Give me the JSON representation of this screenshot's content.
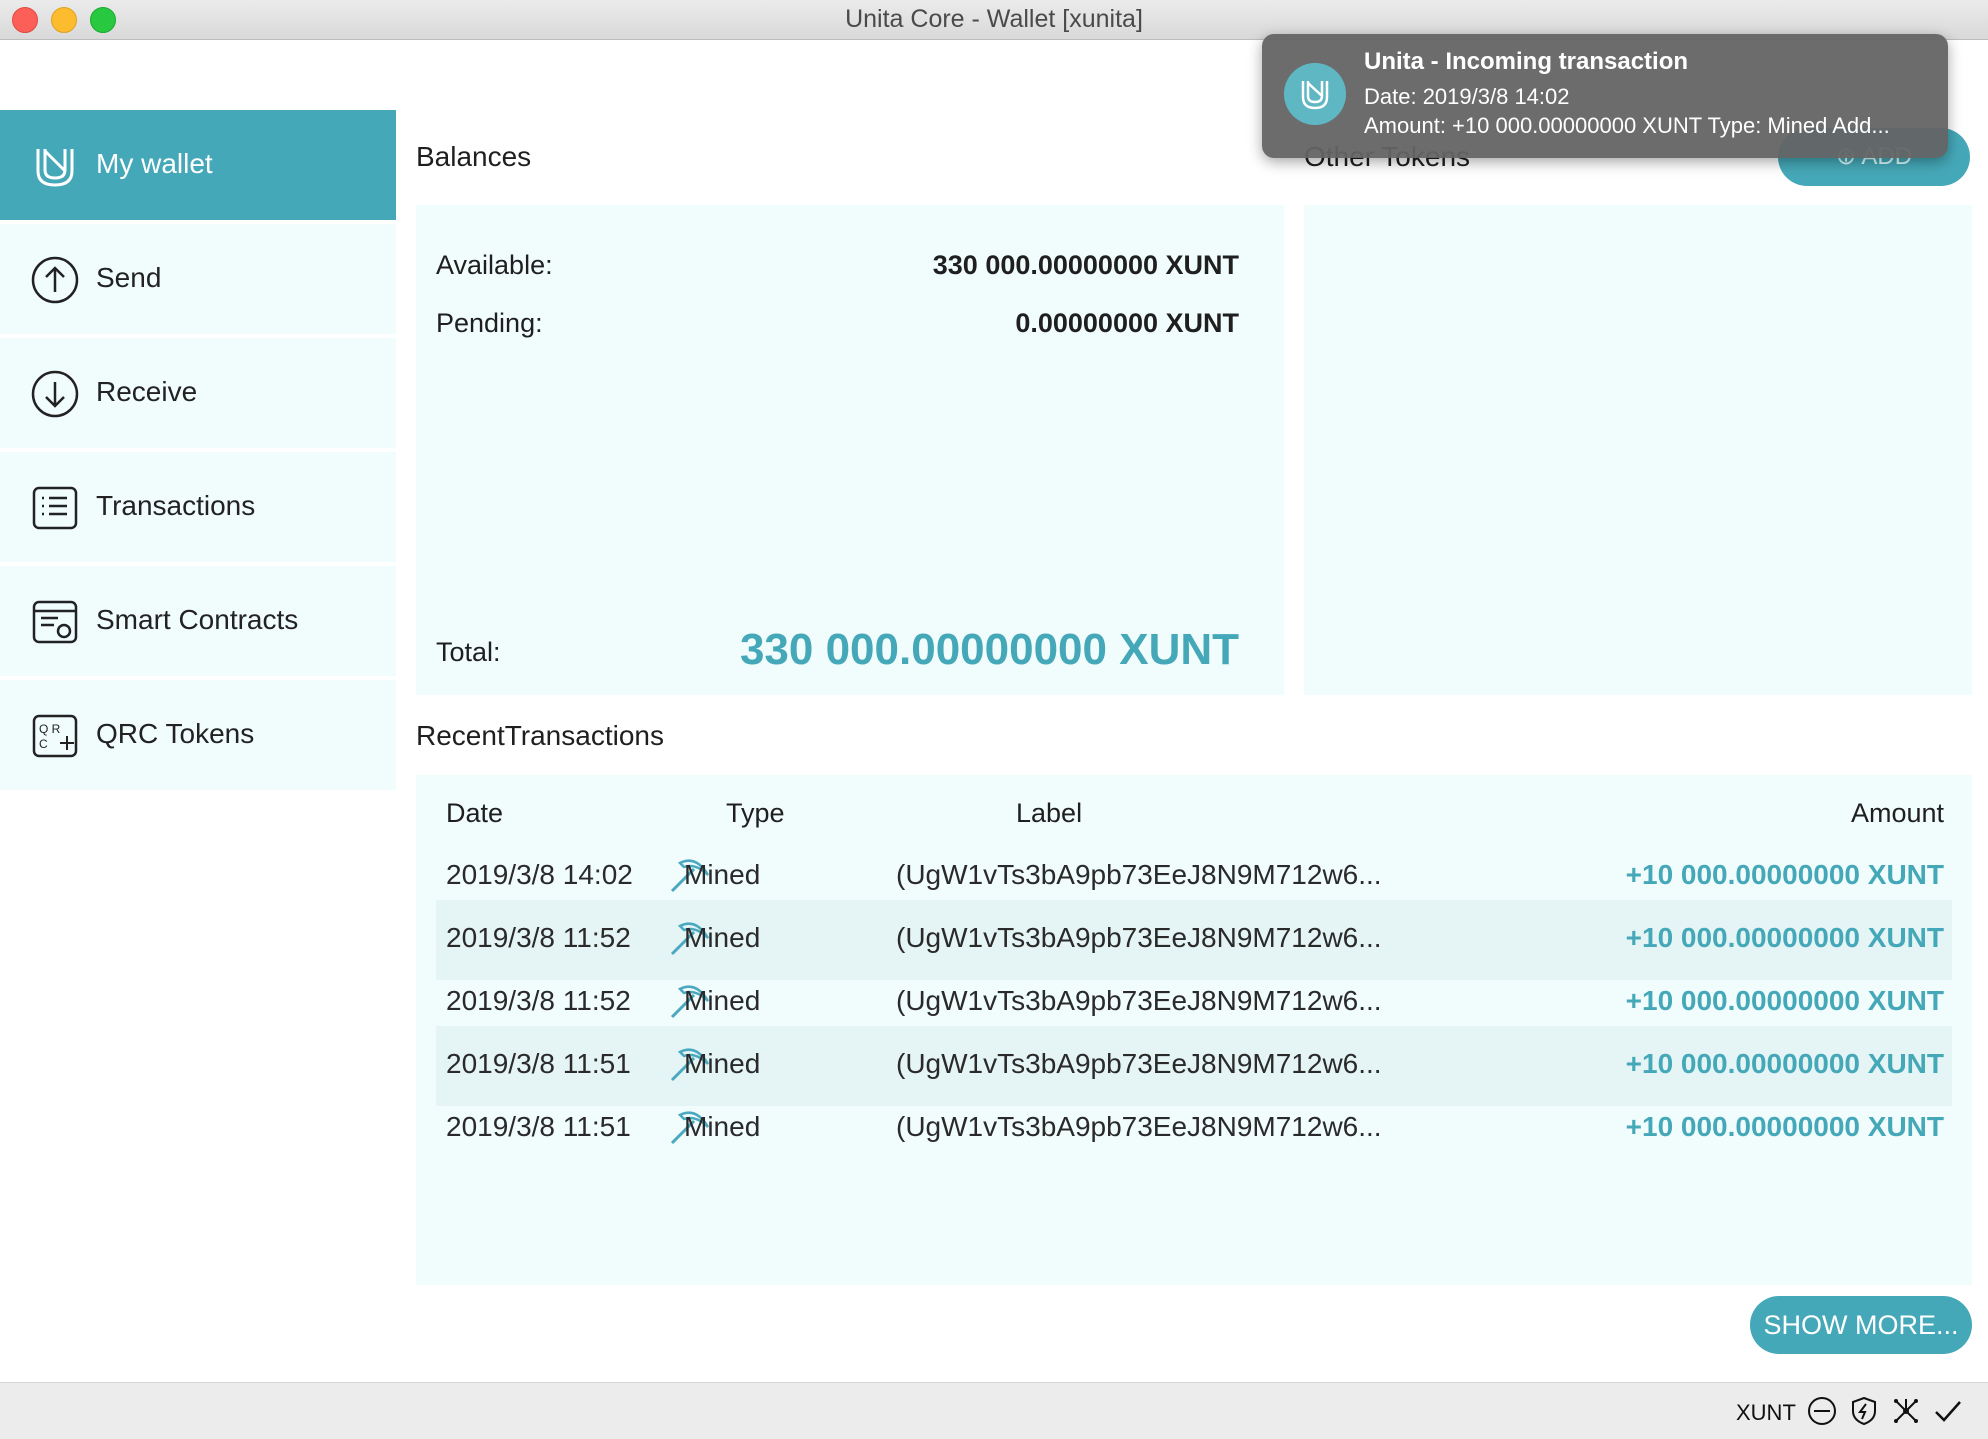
{
  "window": {
    "title": "Unita Core - Wallet [xunita]"
  },
  "sidebar": {
    "items": [
      {
        "label": "My wallet",
        "icon": "wallet-logo-icon",
        "active": true
      },
      {
        "label": "Send",
        "icon": "arrow-up-circle-icon"
      },
      {
        "label": "Receive",
        "icon": "arrow-down-circle-icon"
      },
      {
        "label": "Transactions",
        "icon": "list-icon"
      },
      {
        "label": "Smart Contracts",
        "icon": "contract-icon"
      },
      {
        "label": "QRC Tokens",
        "icon": "qrc-token-icon"
      }
    ]
  },
  "balances": {
    "heading": "Balances",
    "available_label": "Available:",
    "available_value": "330 000.00000000 XUNT",
    "pending_label": "Pending:",
    "pending_value": "0.00000000 XUNT",
    "total_label": "Total:",
    "total_value": "330 000.00000000 XUNT"
  },
  "tokens": {
    "heading": "Other Tokens",
    "add_label": "ADD"
  },
  "recent": {
    "heading": "RecentTransactions",
    "columns": {
      "date": "Date",
      "type": "Type",
      "label": "Label",
      "amount": "Amount"
    },
    "rows": [
      {
        "date": "2019/3/8 14:02",
        "type": "Mined",
        "label": "(UgW1vTs3bA9pb73EeJ8N9M712w6...",
        "amount": "+10 000.00000000 XUNT"
      },
      {
        "date": "2019/3/8 11:52",
        "type": "Mined",
        "label": "(UgW1vTs3bA9pb73EeJ8N9M712w6...",
        "amount": "+10 000.00000000 XUNT"
      },
      {
        "date": "2019/3/8 11:52",
        "type": "Mined",
        "label": "(UgW1vTs3bA9pb73EeJ8N9M712w6...",
        "amount": "+10 000.00000000 XUNT"
      },
      {
        "date": "2019/3/8 11:51",
        "type": "Mined",
        "label": "(UgW1vTs3bA9pb73EeJ8N9M712w6...",
        "amount": "+10 000.00000000 XUNT"
      },
      {
        "date": "2019/3/8 11:51",
        "type": "Mined",
        "label": "(UgW1vTs3bA9pb73EeJ8N9M712w6...",
        "amount": "+10 000.00000000 XUNT"
      }
    ],
    "show_more_label": "SHOW MORE..."
  },
  "statusbar": {
    "unit": "XUNT"
  },
  "notification": {
    "title": "Unita - Incoming transaction",
    "line1": "Date: 2019/3/8 14:02",
    "line2": "Amount: +10 000.00000000 XUNT Type: Mined Add..."
  },
  "colors": {
    "accent": "#45a8b8",
    "panel": "#f1fcfd",
    "row_alt": "#e5f4f5"
  }
}
